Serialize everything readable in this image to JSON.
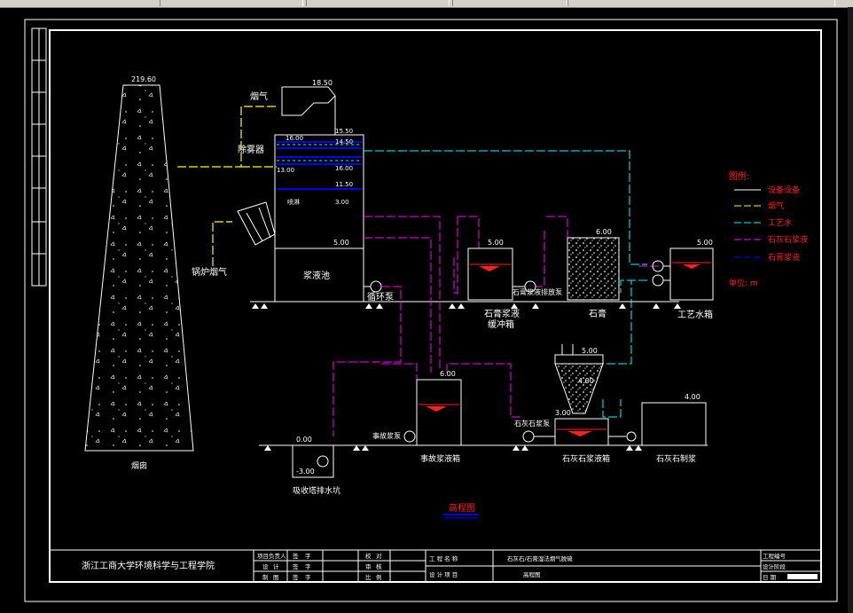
{
  "labels": {
    "chimney_elev": "219.60",
    "chimney_name": "烟囱",
    "flue_gas": "烟气",
    "demister": "除雾器",
    "boiler_gas": "锅炉烟气",
    "tower_top": "18.50",
    "elev_1": "16.00",
    "elev_2": "15.50",
    "elev_3": "14.50",
    "elev_4": "13.00",
    "elev_5": "11.50",
    "elev_6": "3.00",
    "spray": "喷淋",
    "slurry_pool_elev": "5.00",
    "slurry_pool": "浆液池",
    "circ_pump": "循环泵",
    "buffer_elev": "5.00",
    "buffer_tank_1": "石膏浆液",
    "buffer_tank_2": "缓冲箱",
    "gypsum_pump": "石膏浆液排放泵",
    "gypsum_elev": "6.00",
    "gypsum": "石膏",
    "water_tank_elev": "5.00",
    "water_tank": "工艺水箱",
    "silo_elev": "5.00",
    "silo_elev2": "4.00",
    "accident_elev": "6.00",
    "accident_pump": "事故浆泵",
    "accident_tank": "事故浆液箱",
    "sump_elev": "0.00",
    "sump_elev2": "-3.00",
    "sump": "吸收塔排水坑",
    "lime_pump": "石灰石浆泵",
    "lime_elev": "3.00",
    "lime_tank": "石灰石浆液箱",
    "mill_elev": "4.00",
    "mill": "石灰石制浆",
    "drawing_title": "高程图"
  },
  "legend": {
    "title": "图例:",
    "items": [
      "设备设备",
      "烟气",
      "工艺水",
      "石灰石浆液",
      "石膏浆液"
    ],
    "unit": "单位: m",
    "colors": [
      "#ffffff",
      "#ffff00",
      "#00ffff",
      "#ff00ff",
      "#0000ff"
    ]
  },
  "title_block": {
    "school": "浙江工商大学环境科学与工程学院",
    "row1": [
      "项目负责人",
      "签",
      "字",
      "校",
      "对"
    ],
    "row2": [
      "设",
      "计",
      "签",
      "字",
      "审",
      "核"
    ],
    "row3": [
      "制",
      "图",
      "签",
      "字",
      "比",
      "例"
    ],
    "proj_name_label": "工 程 名 称",
    "proj_name": "石灰石/石膏湿法烟气脱硫",
    "design_item_label": "设 计 项 目",
    "design_item": "高程图",
    "right": [
      "工程编号",
      "设计阶段",
      "日  期"
    ]
  }
}
